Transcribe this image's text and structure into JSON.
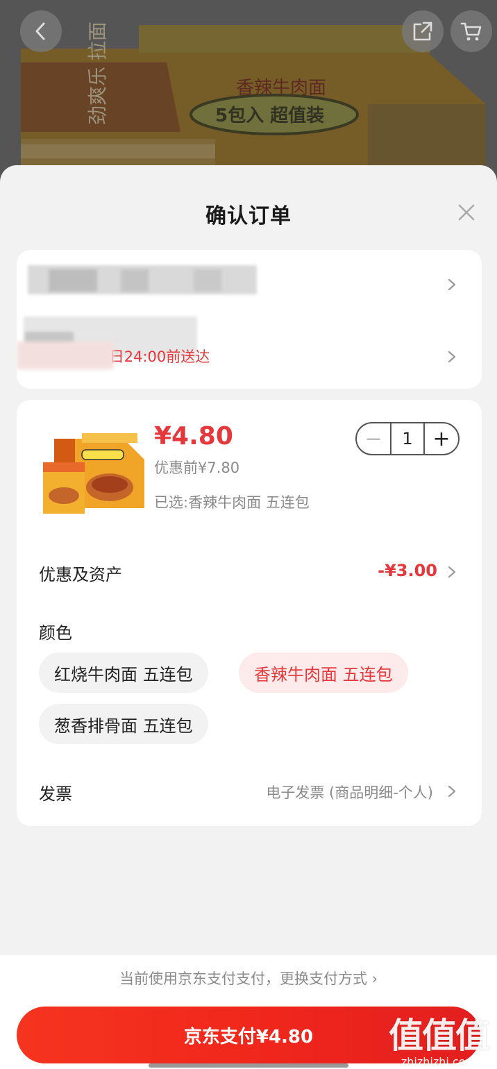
{
  "banner": {
    "package_text": "香辣牛肉面",
    "package_badge": "5包入 超值装",
    "brand_text": "劲爽乐 拉面"
  },
  "sheet": {
    "title": "确认订单"
  },
  "address": {
    "delivery_text": "9月4日24:00前送达"
  },
  "product": {
    "price_now": "¥4.80",
    "price_before": "优惠前¥7.80",
    "selected_spec": "已选:香辣牛肉面 五连包",
    "quantity": "1",
    "minus_label": "−",
    "plus_label": "+"
  },
  "discount": {
    "label": "优惠及资产",
    "value": "-¥3.00"
  },
  "color": {
    "label": "颜色",
    "options": [
      {
        "label": "红烧牛肉面 五连包",
        "selected": false
      },
      {
        "label": "香辣牛肉面 五连包",
        "selected": true
      },
      {
        "label": "葱香排骨面 五连包",
        "selected": false
      }
    ]
  },
  "invoice": {
    "label": "发票",
    "value": "电子发票 (商品明细-个人)"
  },
  "payment": {
    "hint": "当前使用京东支付支付，更换支付方式 ›",
    "button_label": "京东支付¥4.80"
  },
  "watermark": {
    "glyphs": "值值值",
    "url": "zhizhizhi.com"
  },
  "colors": {
    "accent": "#e4393c",
    "pay_button": "#f0261c",
    "chip_active_bg": "#fdeaea"
  }
}
